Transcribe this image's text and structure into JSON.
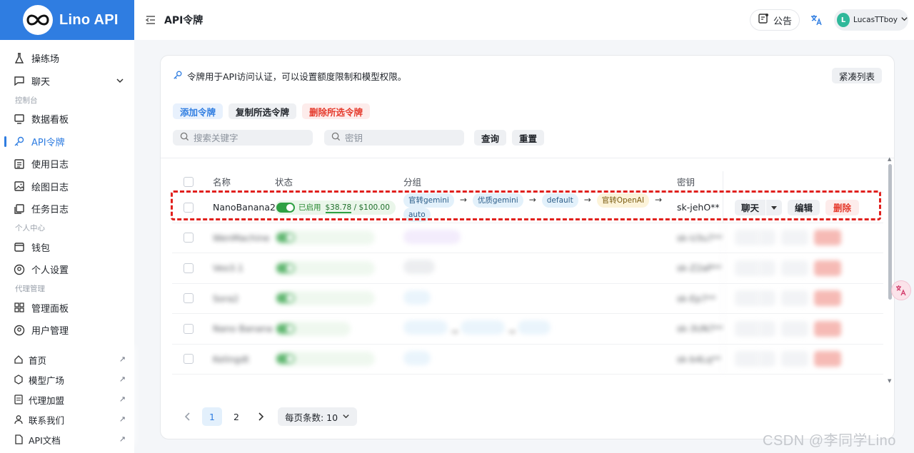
{
  "brand": {
    "name": "Lino API"
  },
  "sidebar": {
    "items_top": [
      {
        "label": "操练场",
        "icon": "flask-icon"
      },
      {
        "label": "聊天",
        "icon": "chat-bubble-icon"
      }
    ],
    "section_console": "控制台",
    "items_console": [
      {
        "label": "数据看板",
        "icon": "monitor-icon"
      },
      {
        "label": "API令牌",
        "icon": "key-icon"
      },
      {
        "label": "使用日志",
        "icon": "log-list-icon"
      },
      {
        "label": "绘图日志",
        "icon": "image-icon"
      },
      {
        "label": "任务日志",
        "icon": "task-icon"
      }
    ],
    "section_personal": "个人中心",
    "items_personal": [
      {
        "label": "钱包",
        "icon": "wallet-icon"
      },
      {
        "label": "个人设置",
        "icon": "user-circle-icon"
      }
    ],
    "section_admin": "代理管理",
    "items_admin": [
      {
        "label": "管理面板",
        "icon": "grid-icon"
      },
      {
        "label": "用户管理",
        "icon": "user-circle-icon"
      }
    ],
    "bottom_links": [
      {
        "label": "首页",
        "icon": "home-icon"
      },
      {
        "label": "模型广场",
        "icon": "cube-icon"
      },
      {
        "label": "代理加盟",
        "icon": "document-icon"
      },
      {
        "label": "联系我们",
        "icon": "user-icon"
      },
      {
        "label": "API文档",
        "icon": "doc-icon"
      }
    ]
  },
  "header": {
    "title": "API令牌",
    "notice_label": "公告",
    "user_initial": "L",
    "user_name": "LucasTTboy"
  },
  "main": {
    "description": "令牌用于API访问认证，可以设置额度限制和模型权限。",
    "compact_label": "紧凑列表",
    "add_label": "添加令牌",
    "copy_label": "复制所选令牌",
    "delete_selected_label": "删除所选令牌",
    "search_placeholder": "搜索关键字",
    "key_placeholder": "密钥",
    "query_label": "查询",
    "reset_label": "重置"
  },
  "table": {
    "columns": {
      "name": "名称",
      "status": "状态",
      "group": "分组",
      "key": "密钥"
    },
    "first_row": {
      "name": "NanoBanana2",
      "status": "已启用",
      "quota_used": "$38.78",
      "quota_total": " / $100.00",
      "quota_fraction": 0.39,
      "groups": [
        "官转gemini",
        "优质gemini",
        "default",
        "官转OpenAI",
        "auto"
      ],
      "key": "sk-jehO**",
      "chat": "聊天",
      "edit": "编辑",
      "delete": "删除"
    },
    "blurred_rows": [
      {
        "name": "WenMachine",
        "key": "sk-U3u7**"
      },
      {
        "name": "Veo3.1",
        "key": "sk-Z2aP**"
      },
      {
        "name": "Sora2",
        "key": "sk-Ep7**"
      },
      {
        "name": "Nano Banana",
        "key": "sk-3UN7**"
      },
      {
        "name": "Kelingdt",
        "key": "sk-b4Lq**"
      }
    ]
  },
  "pager": {
    "pages": [
      "1",
      "2"
    ],
    "page_size_label": "每页条数: 10"
  },
  "watermark": "CSDN @李同学Lino"
}
